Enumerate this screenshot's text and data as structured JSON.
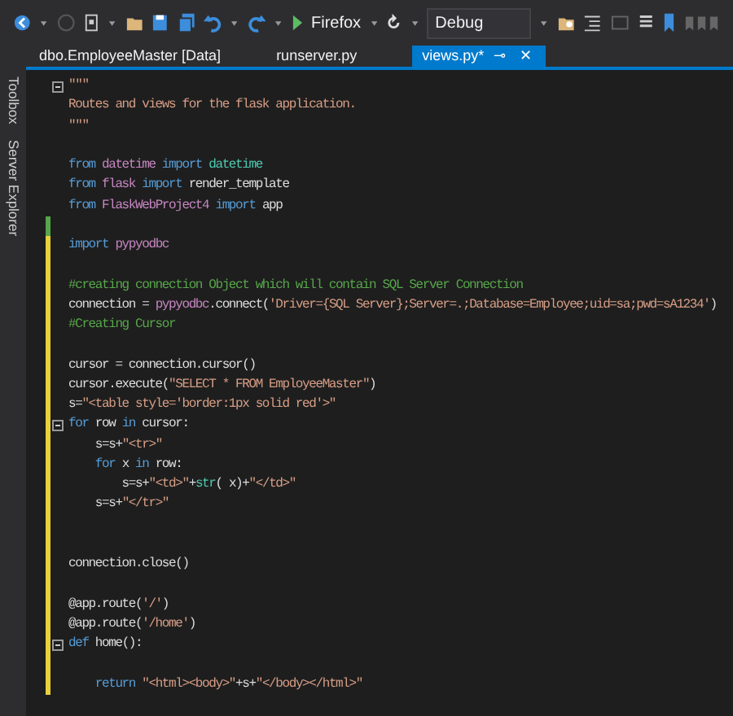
{
  "toolbar": {
    "run_target": "Firefox",
    "configuration": "Debug"
  },
  "side_tabs": [
    "Toolbox",
    "Server Explorer"
  ],
  "tabs": [
    {
      "label": "dbo.EmployeeMaster [Data]",
      "selected": false
    },
    {
      "label": "runserver.py",
      "selected": false
    },
    {
      "label": "views.py*",
      "selected": true,
      "pin": "⊸",
      "close": "✕"
    }
  ],
  "code": {
    "lines": [
      {
        "fold": true,
        "modified": false,
        "tokens": [
          {
            "text": "\"\"\"",
            "kind": "string"
          }
        ]
      },
      {
        "fold": false,
        "modified": false,
        "tokens": [
          {
            "text": "Routes and views for the flask application.",
            "kind": "string"
          }
        ]
      },
      {
        "fold": false,
        "modified": false,
        "tokens": [
          {
            "text": "\"\"\"",
            "kind": "string"
          }
        ]
      },
      {
        "fold": false,
        "modified": false
      },
      {
        "fold": false,
        "modified": false,
        "tokens": [
          {
            "text": "from",
            "kind": "keyword"
          },
          {
            "text": " datetime ",
            "kind": "module"
          },
          {
            "text": "import",
            "kind": "keyword"
          },
          {
            "text": " datetime",
            "kind": "type"
          }
        ]
      },
      {
        "fold": false,
        "modified": false,
        "tokens": [
          {
            "text": "from",
            "kind": "keyword"
          },
          {
            "text": " flask ",
            "kind": "module"
          },
          {
            "text": "import",
            "kind": "keyword"
          },
          {
            "text": " render_template",
            "kind": "plain"
          }
        ]
      },
      {
        "fold": false,
        "modified": false,
        "tokens": [
          {
            "text": "from",
            "kind": "keyword"
          },
          {
            "text": " FlaskWebProject4 ",
            "kind": "module"
          },
          {
            "text": "import",
            "kind": "keyword"
          },
          {
            "text": " app",
            "kind": "plain"
          }
        ]
      },
      {
        "fold": false,
        "modified": true,
        "saved": true
      },
      {
        "fold": false,
        "modified": true,
        "saved": false,
        "tokens": [
          {
            "text": "import",
            "kind": "keyword"
          },
          {
            "text": " pypyodbc",
            "kind": "module"
          }
        ]
      },
      {
        "fold": false,
        "modified": true,
        "saved": false
      },
      {
        "fold": false,
        "modified": true,
        "saved": false,
        "tokens": [
          {
            "text": "#creating connection Object which will contain SQL Server Connection",
            "kind": "comment"
          }
        ]
      },
      {
        "fold": false,
        "modified": true,
        "saved": false,
        "tokens": [
          {
            "text": "connection = ",
            "kind": "plain"
          },
          {
            "text": "pypyodbc",
            "kind": "module"
          },
          {
            "text": ".connect(",
            "kind": "plain"
          },
          {
            "text": "'Driver={SQL Server};Server=.;Database=Employee;uid=sa;pwd=sA1234'",
            "kind": "string"
          },
          {
            "text": ")",
            "kind": "plain"
          }
        ]
      },
      {
        "fold": false,
        "modified": true,
        "saved": false,
        "tokens": [
          {
            "text": "#Creating Cursor",
            "kind": "comment"
          }
        ]
      },
      {
        "fold": false,
        "modified": true,
        "saved": false
      },
      {
        "fold": false,
        "modified": true,
        "saved": false,
        "tokens": [
          {
            "text": "cursor = connection.cursor()",
            "kind": "plain"
          }
        ]
      },
      {
        "fold": false,
        "modified": true,
        "saved": false,
        "tokens": [
          {
            "text": "cursor.execute(",
            "kind": "plain"
          },
          {
            "text": "\"SELECT * FROM EmployeeMaster\"",
            "kind": "string"
          },
          {
            "text": ")",
            "kind": "plain"
          }
        ]
      },
      {
        "fold": false,
        "modified": true,
        "saved": false,
        "tokens": [
          {
            "text": "s=",
            "kind": "plain"
          },
          {
            "text": "\"<table style='border:1px solid red'>\"",
            "kind": "string"
          }
        ]
      },
      {
        "fold": true,
        "modified": true,
        "saved": false,
        "tokens": [
          {
            "text": "for",
            "kind": "keyword"
          },
          {
            "text": " row ",
            "kind": "plain"
          },
          {
            "text": "in",
            "kind": "keyword"
          },
          {
            "text": " cursor:",
            "kind": "plain"
          }
        ]
      },
      {
        "fold": false,
        "modified": true,
        "saved": false,
        "tokens": [
          {
            "text": "    s=s+",
            "kind": "plain"
          },
          {
            "text": "\"<tr>\"",
            "kind": "string"
          }
        ]
      },
      {
        "fold": false,
        "modified": true,
        "saved": false,
        "tokens": [
          {
            "text": "    for",
            "kind": "keyword"
          },
          {
            "text": " x ",
            "kind": "plain"
          },
          {
            "text": "in",
            "kind": "keyword"
          },
          {
            "text": " row:",
            "kind": "plain"
          }
        ]
      },
      {
        "fold": false,
        "modified": true,
        "saved": false,
        "tokens": [
          {
            "text": "        s=s+",
            "kind": "plain"
          },
          {
            "text": "\"<td>\"",
            "kind": "string"
          },
          {
            "text": "+",
            "kind": "plain"
          },
          {
            "text": "str",
            "kind": "type"
          },
          {
            "text": "( x)+",
            "kind": "plain"
          },
          {
            "text": "\"</td>\"",
            "kind": "string"
          }
        ]
      },
      {
        "fold": false,
        "modified": true,
        "saved": false,
        "tokens": [
          {
            "text": "    s=s+",
            "kind": "plain"
          },
          {
            "text": "\"</tr>\"",
            "kind": "string"
          }
        ]
      },
      {
        "fold": false,
        "modified": true,
        "saved": false
      },
      {
        "fold": false,
        "modified": true,
        "saved": false
      },
      {
        "fold": false,
        "modified": true,
        "saved": false,
        "tokens": [
          {
            "text": "connection.close()",
            "kind": "plain"
          }
        ]
      },
      {
        "fold": false,
        "modified": true,
        "saved": false
      },
      {
        "fold": false,
        "modified": true,
        "saved": false,
        "tokens": [
          {
            "text": "@app.route(",
            "kind": "plain"
          },
          {
            "text": "'/'",
            "kind": "string"
          },
          {
            "text": ")",
            "kind": "plain"
          }
        ]
      },
      {
        "fold": false,
        "modified": true,
        "saved": false,
        "tokens": [
          {
            "text": "@app.route(",
            "kind": "plain"
          },
          {
            "text": "'/home'",
            "kind": "string"
          },
          {
            "text": ")",
            "kind": "plain"
          }
        ]
      },
      {
        "fold": true,
        "modified": true,
        "saved": false,
        "tokens": [
          {
            "text": "def",
            "kind": "keyword"
          },
          {
            "text": " home():",
            "kind": "plain"
          }
        ]
      },
      {
        "fold": false,
        "modified": true,
        "saved": false
      },
      {
        "fold": false,
        "modified": true,
        "saved": false,
        "tokens": [
          {
            "text": "    return",
            "kind": "keyword"
          },
          {
            "text": " \"<html><body>\"",
            "kind": "string"
          },
          {
            "text": "+s+",
            "kind": "plain"
          },
          {
            "text": "\"</body></html>\"",
            "kind": "string"
          }
        ]
      }
    ]
  }
}
